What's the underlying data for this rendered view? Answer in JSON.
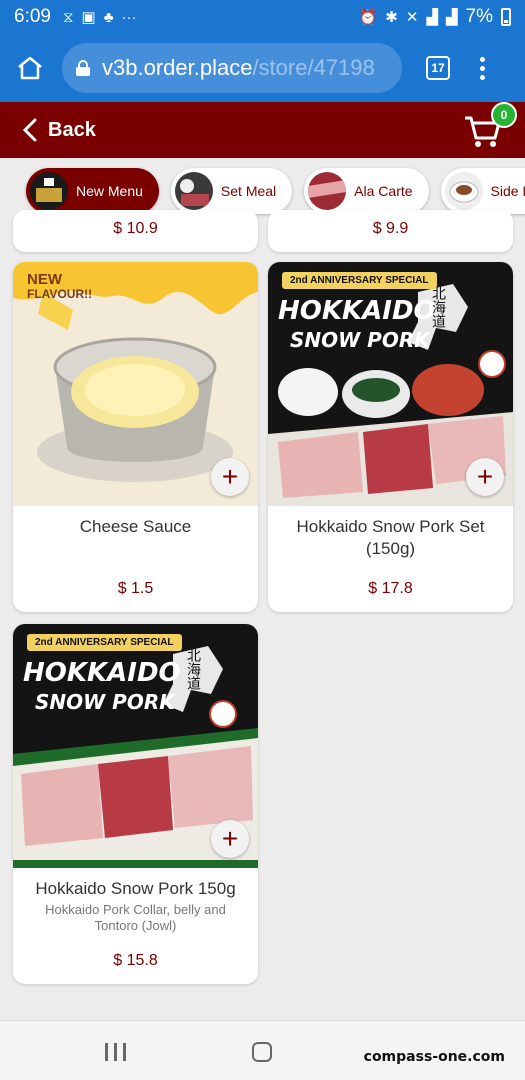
{
  "status_bar": {
    "time": "6:09",
    "battery": "7%",
    "left_icons": [
      "hourglass-icon",
      "image-icon",
      "teams-icon",
      "more-dots-icon"
    ],
    "right_icons": [
      "alarm-icon",
      "bluetooth-icon",
      "mute-icon",
      "signal-icon",
      "wifi-icon"
    ]
  },
  "browser": {
    "url_host": "v3b.order.place",
    "url_path": "/store/47198",
    "tab_count": "17"
  },
  "header": {
    "back_label": "Back",
    "cart_count": "0",
    "color": "#7a0000"
  },
  "categories": [
    {
      "label": "New Menu",
      "active": true
    },
    {
      "label": "Set Meal",
      "active": false
    },
    {
      "label": "Ala Carte",
      "active": false
    },
    {
      "label": "Side Dish",
      "active": false
    }
  ],
  "products": [
    {
      "price": "$ 10.9"
    },
    {
      "price": "$ 9.9"
    },
    {
      "name": "Cheese Sauce",
      "description": "",
      "price": "$ 1.5",
      "badge_line1": "NEW",
      "badge_line2": "FLAVOUR!!"
    },
    {
      "name": "Hokkaido Snow Pork Set (150g)",
      "description": "",
      "price": "$ 17.8",
      "banner": "2nd ANNIVERSARY SPECIAL",
      "title1": "HOKKAIDO",
      "title2": "SNOW PORK",
      "jp": "北海道"
    },
    {
      "name": "Hokkaido Snow Pork 150g",
      "description": "Hokkaido Pork Collar, belly and Tontoro (Jowl)",
      "price": "$ 15.8",
      "banner": "2nd ANNIVERSARY SPECIAL",
      "title1": "HOKKAIDO",
      "title2": "SNOW PORK",
      "jp": "北海道"
    }
  ],
  "watermark": "compass-one.com"
}
